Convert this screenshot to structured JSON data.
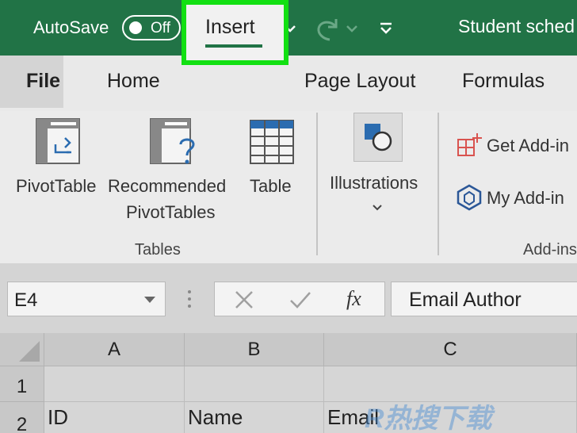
{
  "titlebar": {
    "autosave_label": "AutoSave",
    "autosave_state": "Off",
    "document_title": "Student sched",
    "icons": [
      "save-icon",
      "undo-icon",
      "redo-icon",
      "customize-toolbar-icon"
    ]
  },
  "tabs": {
    "file": "File",
    "home": "Home",
    "insert": "Insert",
    "page_layout": "Page Layout",
    "formulas": "Formulas"
  },
  "ribbon": {
    "pivottable": "PivotTable",
    "recommended_line1": "Recommended",
    "recommended_line2": "PivotTables",
    "table": "Table",
    "tables_group": "Tables",
    "illustrations": "Illustrations",
    "get_addins": "Get Add-in",
    "my_addins": "My Add-in",
    "addins_group": "Add-ins"
  },
  "formula_bar": {
    "name_box": "E4",
    "fx_label": "fx",
    "formula_value": "Email Author"
  },
  "grid": {
    "columns": [
      "A",
      "B",
      "C"
    ],
    "rows": [
      "1",
      "2"
    ],
    "row2": [
      "ID",
      "Name",
      "Email"
    ]
  },
  "watermark": "R热搜下载",
  "colors": {
    "title_bar": "#217346",
    "highlight": "#12e012",
    "tab_underline": "#217346",
    "addin_red": "#d9534f",
    "addin_blue": "#2b5797"
  }
}
